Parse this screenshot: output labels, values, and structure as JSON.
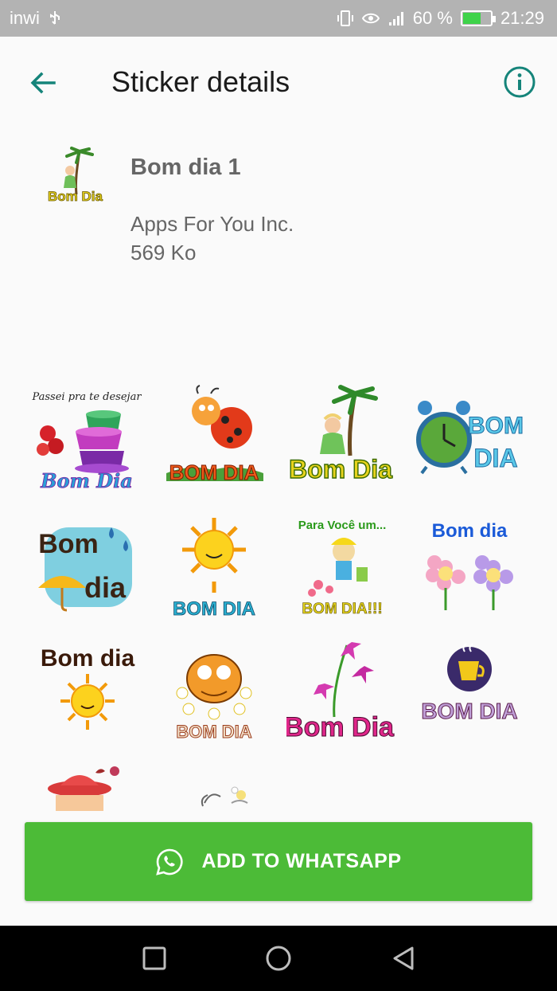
{
  "status_bar": {
    "carrier": "inwi",
    "battery_percent": "60 %",
    "battery_level": 0.6,
    "time": "21:29"
  },
  "app_bar": {
    "title": "Sticker details",
    "back_icon": "arrow-left-icon",
    "info_icon": "info-icon"
  },
  "pack": {
    "name": "Bom dia 1",
    "publisher": "Apps For You Inc.",
    "size": "569 Ko"
  },
  "stickers": {
    "s1_line1": "Passei pra te desejar",
    "s1_line2": "Bom Dia",
    "s2": "BOM DIA",
    "s3": "Bom Dia",
    "s4_a": "BOM",
    "s4_b": "DIA",
    "s5_a": "Bom",
    "s5_b": "dia",
    "s6": "BOM DIA",
    "s7_line1": "Para Você um...",
    "s7_line2": "BOM DIA!!!",
    "s8": "Bom dia",
    "s9": "Bom dia",
    "s10": "BOM DIA",
    "s11": "Bom Dia",
    "s12": "BOM DIA"
  },
  "add_button": {
    "label": "ADD TO WHATSAPP",
    "color": "#4cbb37"
  },
  "colors": {
    "accent": "#15847a"
  }
}
